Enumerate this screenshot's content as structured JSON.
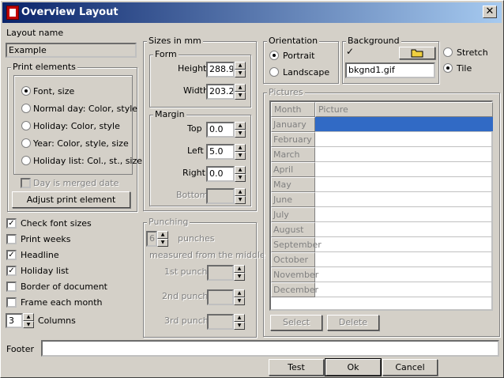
{
  "window": {
    "title": "Overview Layout"
  },
  "layout_name": {
    "label": "Layout name",
    "value": "Example"
  },
  "print_elements": {
    "label": "Print elements",
    "options": [
      "Font, size",
      "Normal day: Color, style",
      "Holiday: Color, style",
      "Year: Color, style, size",
      "Holiday list: Col., st., size"
    ],
    "selected_index": 0,
    "day_is_merged": "Day is merged date",
    "adjust_button": "Adjust print element"
  },
  "checks": {
    "check_font_sizes": {
      "label": "Check font sizes",
      "checked": true
    },
    "print_weeks": {
      "label": "Print weeks",
      "checked": false
    },
    "headline": {
      "label": "Headline",
      "checked": true
    },
    "holiday_list": {
      "label": "Holiday list",
      "checked": true
    },
    "border_of_document": {
      "label": "Border of document",
      "checked": false
    },
    "frame_each_month": {
      "label": "Frame each month",
      "checked": false
    }
  },
  "columns": {
    "value": "3",
    "label": "Columns"
  },
  "sizes": {
    "label": "Sizes in mm",
    "form": {
      "label": "Form",
      "height_label": "Height",
      "height": "288.9",
      "width_label": "Width",
      "width": "203.2"
    },
    "margin": {
      "label": "Margin",
      "top_label": "Top",
      "top": "0.0",
      "left_label": "Left",
      "left": "5.0",
      "right_label": "Right",
      "right": "0.0",
      "bottom_label": "Bottom",
      "bottom": ""
    }
  },
  "punching": {
    "label": "Punching",
    "count": "6",
    "punches_label": "punches",
    "measured_label": "measured from the middle",
    "first_label": "1st punch",
    "second_label": "2nd punch",
    "third_label": "3rd punch"
  },
  "orientation": {
    "label": "Orientation",
    "portrait": "Portrait",
    "landscape": "Landscape",
    "selected": "portrait"
  },
  "background": {
    "label": "Background",
    "checked": true,
    "check_mark": "✓",
    "file": "bkgnd1.gif",
    "stretch": "Stretch",
    "tile": "Tile",
    "selected": "tile"
  },
  "pictures": {
    "label": "Pictures",
    "col_month": "Month",
    "col_picture": "Picture",
    "months": [
      "January",
      "February",
      "March",
      "April",
      "May",
      "June",
      "July",
      "August",
      "September",
      "October",
      "November",
      "December"
    ],
    "selected_index": 0,
    "select_button": "Select",
    "delete_button": "Delete"
  },
  "footer": {
    "label": "Footer",
    "value": ""
  },
  "buttons": {
    "test": "Test",
    "ok": "Ok",
    "cancel": "Cancel"
  },
  "colors": {
    "title_start": "#0a246a",
    "title_end": "#a6caf0",
    "selection": "#316ac5",
    "dialog_bg": "#d4d0c8"
  }
}
